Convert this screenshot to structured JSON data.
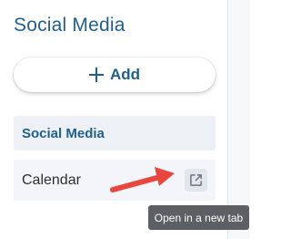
{
  "panel": {
    "title": "Social Media"
  },
  "add_button": {
    "label": "Add",
    "icon": "plus-icon"
  },
  "section": {
    "header_label": "Social Media",
    "items": [
      {
        "label": "Calendar",
        "action_icon": "open-in-new-tab-icon"
      }
    ]
  },
  "tooltip": {
    "text": "Open in a new tab"
  },
  "colors": {
    "accent": "#1f5f8b",
    "annotation_arrow": "#e8473f",
    "tooltip_bg": "#5c5f63"
  }
}
